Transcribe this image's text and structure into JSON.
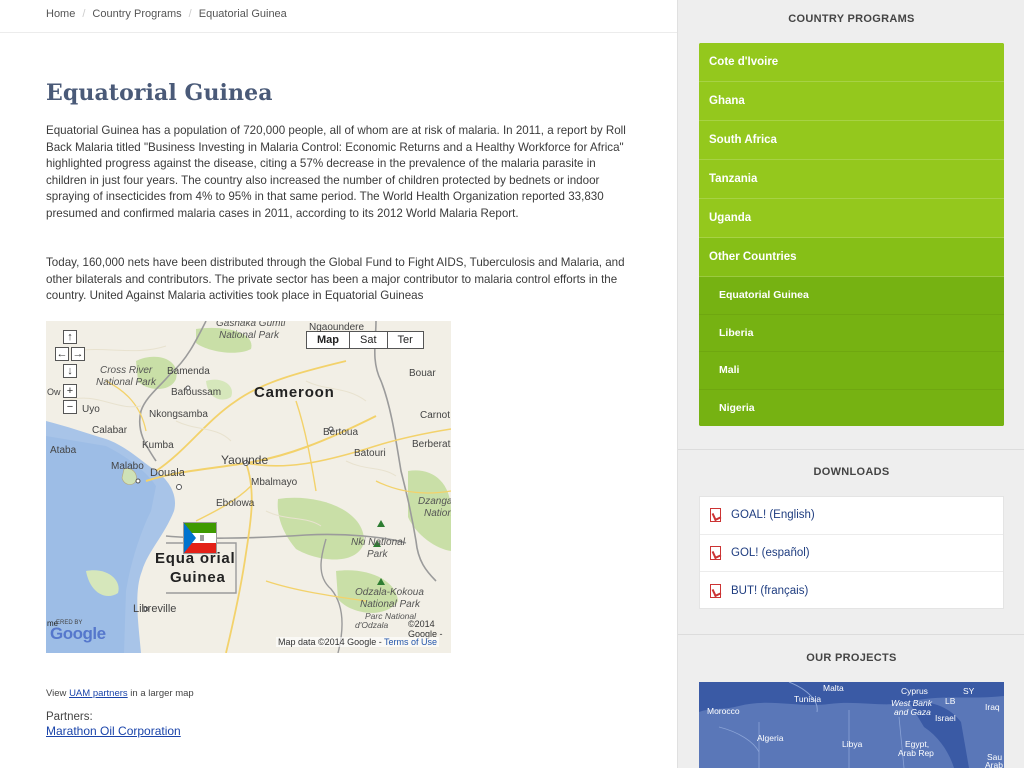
{
  "breadcrumb": {
    "home": "Home",
    "section": "Country Programs",
    "current": "Equatorial Guinea"
  },
  "page": {
    "title": "Equatorial Guinea",
    "para1": "Equatorial Guinea has a population of 720,000 people, all of whom are at risk of malaria. In 2011, a report by Roll Back Malaria titled \"Business Investing in Malaria Control: Economic Returns and a Healthy Workforce for Africa\" highlighted progress against the disease, citing a 57% decrease in the prevalence of the malaria parasite in children in just four years. The country also increased the number of children protected by bednets or indoor spraying of insecticides from 4% to 95% in that same period. The World Health Organization reported 33,830 presumed and confirmed malaria cases in 2011, according to its 2012 World Malaria Report.",
    "para2": "Today, 160,000 nets have been distributed through the Global Fund to Fight AIDS, Tuberculosis and Malaria, and other bilaterals and contributors. The private sector has been a major contributor to malaria control efforts in the country. United Against Malaria activities took place in Equatorial Guineas"
  },
  "map": {
    "type_buttons": [
      "Map",
      "Sat",
      "Ter"
    ],
    "labels": {
      "cameroon": "Cameroon",
      "eq_guinea_line1": "Equa orial",
      "eq_guinea_line2": "Guinea",
      "gashaka": "Gashaka Gumti",
      "national_park": "National Park",
      "ngaoundere": "Ngaoundere",
      "cross_river": "Cross River",
      "cross_river_park": "National Park",
      "bamenda": "Bamenda",
      "bafoussam": "Bafoussam",
      "bouar": "Bouar",
      "nkongsamba": "Nkongsamba",
      "uyo": "Uyo",
      "calabar": "Calabar",
      "carnot": "Carnot",
      "kumba": "Kumba",
      "bertoua": "Bertoua",
      "ataba": "Ataba",
      "batouri": "Batouri",
      "berberati": "Berberati",
      "malabo": "Malabo",
      "douala": "Douala",
      "yaounde": "Yaounde",
      "mbalmayo": "Mbalmayo",
      "ebolowa": "Ebolowa",
      "dzanga": "Dzanga",
      "nation": "Nation",
      "nki": "Nki National",
      "nki_park": "Park",
      "libreville": "Libreville",
      "odzala": "Odzala-Kokoua",
      "odzala_park": "National Park",
      "parc": "Parc National",
      "odzala_short": "d'Odzala",
      "ow": "Ow"
    },
    "google": "Google",
    "powered": "ERED BY",
    "mini_left": "me",
    "copyright": "©2014 Google -",
    "credit_prefix": "Map data ©2014 Google - ",
    "credit_terms": "Terms of Use"
  },
  "view_line": {
    "prefix": "View ",
    "link": "UAM partners",
    "suffix": " in a larger map"
  },
  "partners": {
    "label": "Partners:",
    "link": "Marathon Oil Corporation"
  },
  "sidebar": {
    "programs_heading": "COUNTRY PROGRAMS",
    "programs": [
      "Cote d'Ivoire",
      "Ghana",
      "South Africa",
      "Tanzania",
      "Uganda",
      "Other Countries"
    ],
    "sub_programs": [
      "Equatorial Guinea",
      "Liberia",
      "Mali",
      "Nigeria"
    ],
    "downloads_heading": "DOWNLOADS",
    "downloads": [
      "GOAL! (English)",
      "GOL! (español)",
      "BUT! (français)"
    ],
    "projects_heading": "OUR PROJECTS",
    "projects_labels": {
      "malta": "Malta",
      "cyprus": "Cyprus",
      "sy": "SY",
      "tunisia": "Tunisia",
      "lb": "LB",
      "iraq": "Iraq",
      "morocco": "Morocco",
      "westbank": "West Bank",
      "gaza": "and Gaza",
      "israel": "Israel",
      "algeria": "Algeria",
      "libya": "Libya",
      "egypt": "Egypt,",
      "arab_rep": "Arab Rep",
      "sau": "Sau",
      "arab": "Arab"
    }
  },
  "colors": {
    "green": "#8cc418",
    "green_dark": "#76b212",
    "title": "#4a5a78",
    "link": "#1a44aa"
  }
}
